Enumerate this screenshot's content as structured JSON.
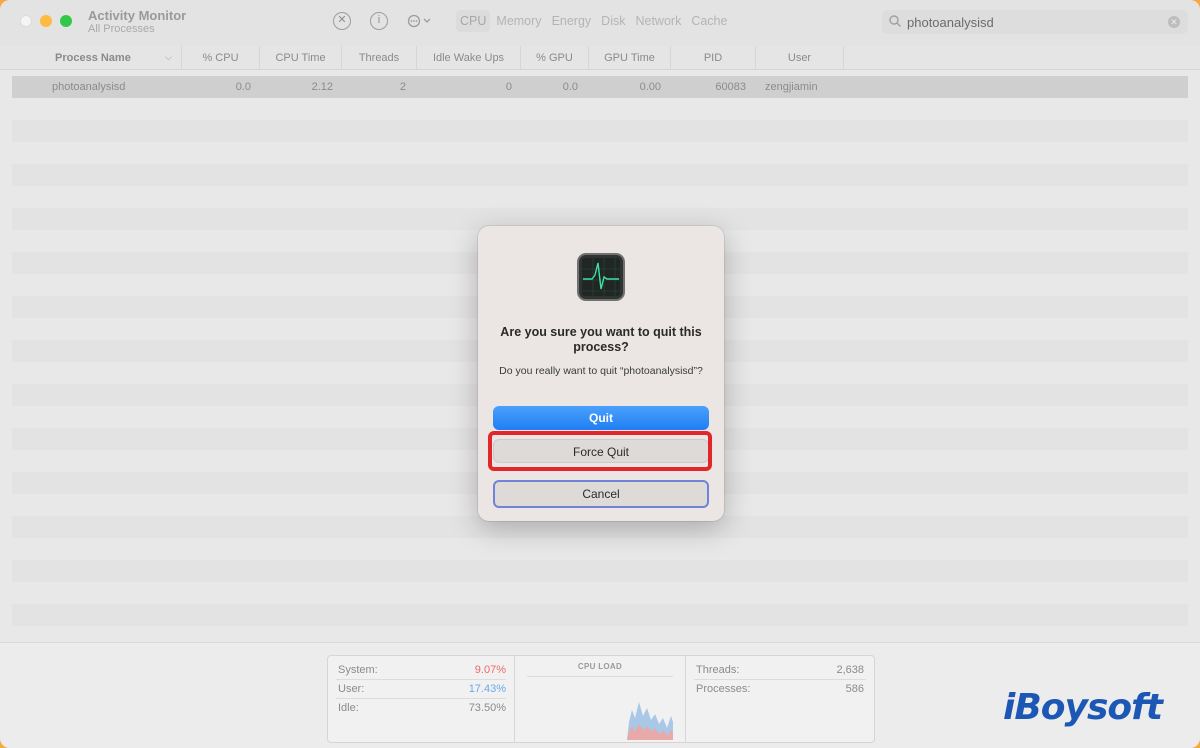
{
  "toolbar": {
    "app_title": "Activity Monitor",
    "app_subtitle": "All Processes",
    "icons": [
      "stop-icon",
      "info-icon",
      "more-icon"
    ],
    "tabs": [
      {
        "label": "CPU",
        "active": true
      },
      {
        "label": "Memory",
        "active": false
      },
      {
        "label": "Energy",
        "active": false
      },
      {
        "label": "Disk",
        "active": false
      },
      {
        "label": "Network",
        "active": false
      },
      {
        "label": "Cache",
        "active": false
      }
    ],
    "search_value": "photoanalysisd"
  },
  "columns": [
    "Process Name",
    "% CPU",
    "CPU Time",
    "Threads",
    "Idle Wake Ups",
    "% GPU",
    "GPU Time",
    "PID",
    "User"
  ],
  "rows": [
    {
      "name": "photoanalysisd",
      "cpu": "0.0",
      "cpu_time": "2.12",
      "threads": "2",
      "idle_wake_ups": "0",
      "gpu": "0.0",
      "gpu_time": "0.00",
      "pid": "60083",
      "user": "zengjiamin"
    }
  ],
  "footer": {
    "system_label": "System:",
    "system_value": "9.07%",
    "user_label": "User:",
    "user_value": "17.43%",
    "idle_label": "Idle:",
    "idle_value": "73.50%",
    "cpu_load_title": "CPU LOAD",
    "threads_label": "Threads:",
    "threads_value": "2,638",
    "processes_label": "Processes:",
    "processes_value": "586"
  },
  "dialog": {
    "title": "Are you sure you want to quit this process?",
    "message": "Do you really want to quit “photoanalysisd”?",
    "quit_label": "Quit",
    "force_quit_label": "Force Quit",
    "cancel_label": "Cancel"
  },
  "watermark": "iBoysoft",
  "colors": {
    "accent_blue": "#1f7ef3",
    "highlight_red": "#e2262a",
    "system_red": "#e96a6a",
    "user_blue": "#6aa9e9"
  }
}
